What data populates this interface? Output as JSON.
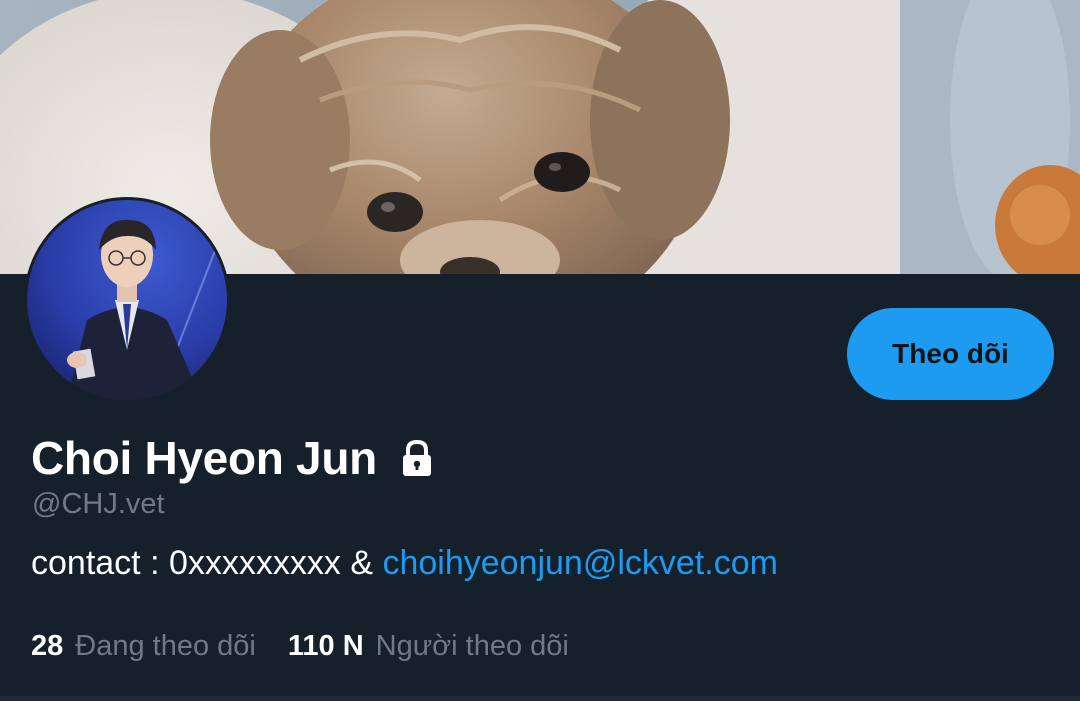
{
  "profile": {
    "display_name": "Choi Hyeon Jun",
    "handle": "@CHJ.vet",
    "protected_icon": "lock-icon",
    "bio_text": "contact : 0xxxxxxxxx & ",
    "bio_link": "choihyeonjun@lckvet.com"
  },
  "actions": {
    "follow_label": "Theo dõi"
  },
  "stats": {
    "following_count": "28",
    "following_label": "Đang theo dõi",
    "followers_count": "110 N",
    "followers_label": "Người theo dõi"
  },
  "colors": {
    "background": "#15202b",
    "accent": "#1d9bf0",
    "muted_text": "#6e7a86"
  }
}
